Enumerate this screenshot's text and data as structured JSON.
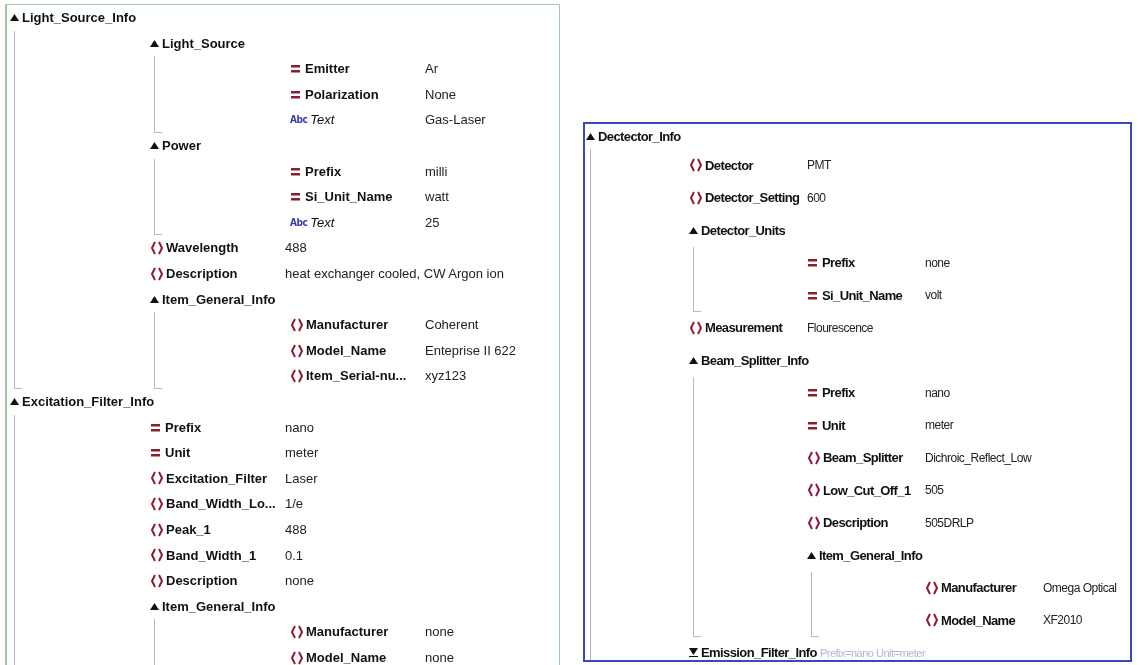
{
  "panels": [
    {
      "nodes": [
        {
          "kind": "group",
          "name": "Light_Source_Info",
          "expanded": true,
          "children": [
            {
              "kind": "group",
              "name": "Light_Source",
              "expanded": true,
              "children": [
                {
                  "kind": "attribute",
                  "name": "Emitter",
                  "value": "Ar"
                },
                {
                  "kind": "attribute",
                  "name": "Polarization",
                  "value": "None"
                },
                {
                  "kind": "text",
                  "icon": "Abc",
                  "name": "Text",
                  "value": "Gas-Laser"
                }
              ]
            },
            {
              "kind": "group",
              "name": "Power",
              "expanded": true,
              "children": [
                {
                  "kind": "attribute",
                  "name": "Prefix",
                  "value": "milli"
                },
                {
                  "kind": "attribute",
                  "name": "Si_Unit_Name",
                  "value": "watt"
                },
                {
                  "kind": "text",
                  "icon": "Abc",
                  "name": "Text",
                  "value": "25"
                }
              ]
            },
            {
              "kind": "element",
              "name": "Wavelength",
              "value": "488"
            },
            {
              "kind": "element",
              "name": "Description",
              "value": "heat exchanger cooled, CW Argon ion"
            },
            {
              "kind": "group",
              "name": "Item_General_Info",
              "expanded": true,
              "children": [
                {
                  "kind": "element",
                  "name": "Manufacturer",
                  "value": "Coherent"
                },
                {
                  "kind": "element",
                  "name": "Model_Name",
                  "value": "Enteprise II 622"
                },
                {
                  "kind": "element",
                  "name": "Item_Serial-nu...",
                  "value": "xyz123"
                }
              ]
            }
          ]
        },
        {
          "kind": "group",
          "name": "Excitation_Filter_Info",
          "expanded": true,
          "children": [
            {
              "kind": "attribute",
              "name": "Prefix",
              "value": "nano"
            },
            {
              "kind": "attribute",
              "name": "Unit",
              "value": "meter"
            },
            {
              "kind": "element",
              "name": "Excitation_Filter",
              "value": "Laser"
            },
            {
              "kind": "element",
              "name": "Band_Width_Lo...",
              "value": "1/e"
            },
            {
              "kind": "element",
              "name": "Peak_1",
              "value": "488"
            },
            {
              "kind": "element",
              "name": "Band_Width_1",
              "value": "0.1"
            },
            {
              "kind": "element",
              "name": "Description",
              "value": "none"
            },
            {
              "kind": "group",
              "name": "Item_General_Info",
              "expanded": true,
              "children": [
                {
                  "kind": "element",
                  "name": "Manufacturer",
                  "value": "none"
                },
                {
                  "kind": "element",
                  "name": "Model_Name",
                  "value": "none"
                }
              ]
            }
          ]
        }
      ]
    },
    {
      "nodes": [
        {
          "kind": "group",
          "name": "Dectector_Info",
          "expanded": true,
          "children": [
            {
              "kind": "element",
              "name": "Detector",
              "value": "PMT"
            },
            {
              "kind": "element",
              "name": "Detector_Setting",
              "value": "600"
            },
            {
              "kind": "group",
              "name": "Detector_Units",
              "expanded": true,
              "children": [
                {
                  "kind": "attribute",
                  "name": "Prefix",
                  "value": "none"
                },
                {
                  "kind": "attribute",
                  "name": "Si_Unit_Name",
                  "value": "volt"
                }
              ]
            },
            {
              "kind": "element",
              "name": "Measurement",
              "value": "Flourescence"
            },
            {
              "kind": "group",
              "name": "Beam_Splitter_Info",
              "expanded": true,
              "children": [
                {
                  "kind": "attribute",
                  "name": "Prefix",
                  "value": "nano"
                },
                {
                  "kind": "attribute",
                  "name": "Unit",
                  "value": "meter"
                },
                {
                  "kind": "element",
                  "name": "Beam_Splitter",
                  "value": "Dichroic_Reflect_Low"
                },
                {
                  "kind": "element",
                  "name": "Low_Cut_Off_1",
                  "value": "505"
                },
                {
                  "kind": "element",
                  "name": "Description",
                  "value": "505DRLP"
                },
                {
                  "kind": "group",
                  "name": "Item_General_Info",
                  "expanded": true,
                  "children": [
                    {
                      "kind": "element",
                      "name": "Manufacturer",
                      "value": "Omega Optical"
                    },
                    {
                      "kind": "element",
                      "name": "Model_Name",
                      "value": "XF2010"
                    }
                  ]
                }
              ]
            },
            {
              "kind": "group",
              "name": "Emission_Filter_Info",
              "expanded": false,
              "summary": "Prefix=nano Unit=meter"
            }
          ]
        }
      ]
    }
  ]
}
